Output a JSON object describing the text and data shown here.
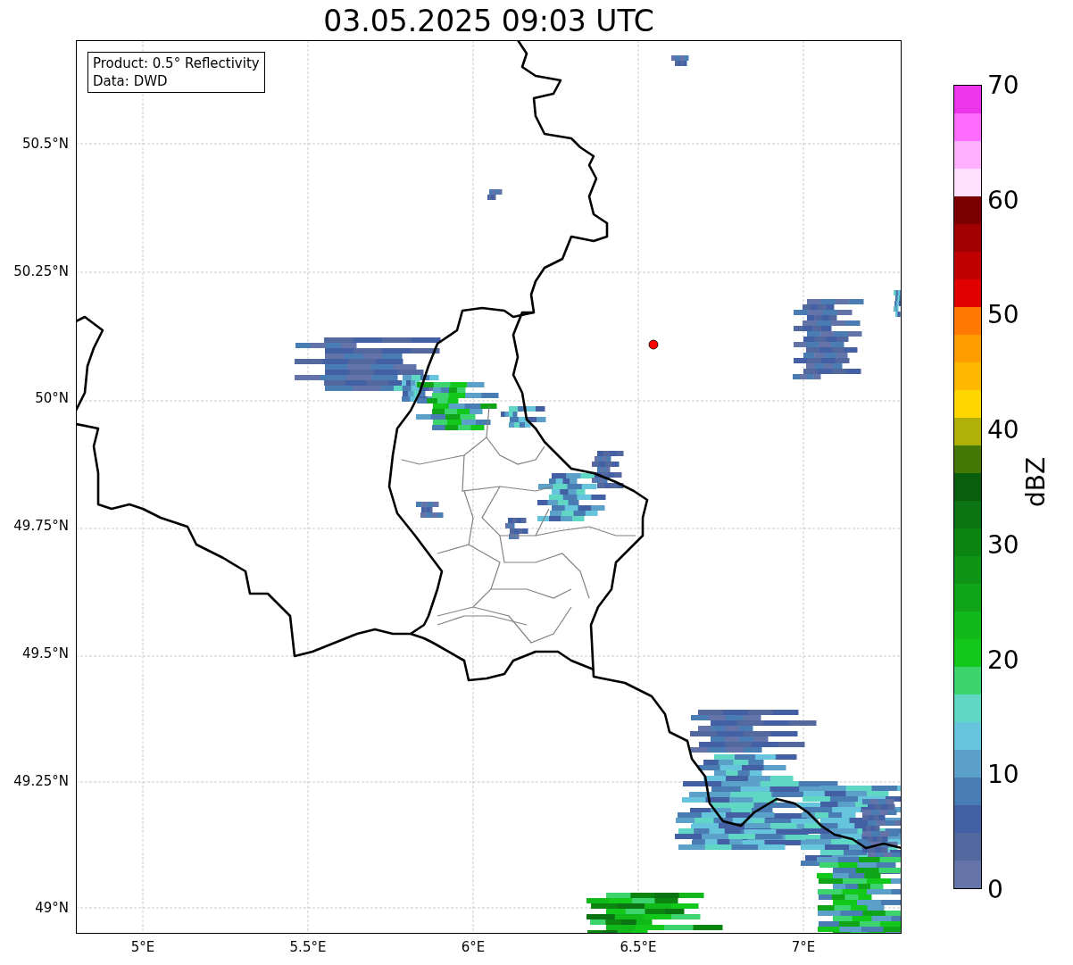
{
  "title": "03.05.2025 09:03 UTC",
  "legend": [
    "Product: 0.5° Reflectivity",
    "Data: DWD"
  ],
  "map": {
    "lat_labels": [
      "50.5°N",
      "50.25°N",
      "50°N",
      "49.75°N",
      "49.5°N",
      "49.25°N",
      "49°N"
    ],
    "lon_labels": [
      "5°E",
      "5.5°E",
      "6°E",
      "6.5°E",
      "7°E"
    ]
  },
  "colorbar": {
    "label": "dBZ",
    "ticks": [
      "70",
      "60",
      "50",
      "40",
      "30",
      "20",
      "10",
      "0"
    ],
    "segments": [
      {
        "color": "#ec36ec"
      },
      {
        "color": "#ff6cff"
      },
      {
        "color": "#ffb0ff"
      },
      {
        "color": "#ffe0ff"
      },
      {
        "color": "#7a0000"
      },
      {
        "color": "#a00000"
      },
      {
        "color": "#c00000"
      },
      {
        "color": "#e00000"
      },
      {
        "color": "#ff7a00"
      },
      {
        "color": "#ff9c00"
      },
      {
        "color": "#ffb800"
      },
      {
        "color": "#ffd600"
      },
      {
        "color": "#b0b008"
      },
      {
        "color": "#467808"
      },
      {
        "color": "#085e0c"
      },
      {
        "color": "#0a7412"
      },
      {
        "color": "#0c8410"
      },
      {
        "color": "#0e9414"
      },
      {
        "color": "#10a418"
      },
      {
        "color": "#10b81a"
      },
      {
        "color": "#12c81a"
      },
      {
        "color": "#3cd46c"
      },
      {
        "color": "#60d6c4"
      },
      {
        "color": "#66c4dc"
      },
      {
        "color": "#5aa0c8"
      },
      {
        "color": "#4a7cb4"
      },
      {
        "color": "#4460a4"
      },
      {
        "color": "#5468a0"
      },
      {
        "color": "#6474a8"
      }
    ]
  }
}
